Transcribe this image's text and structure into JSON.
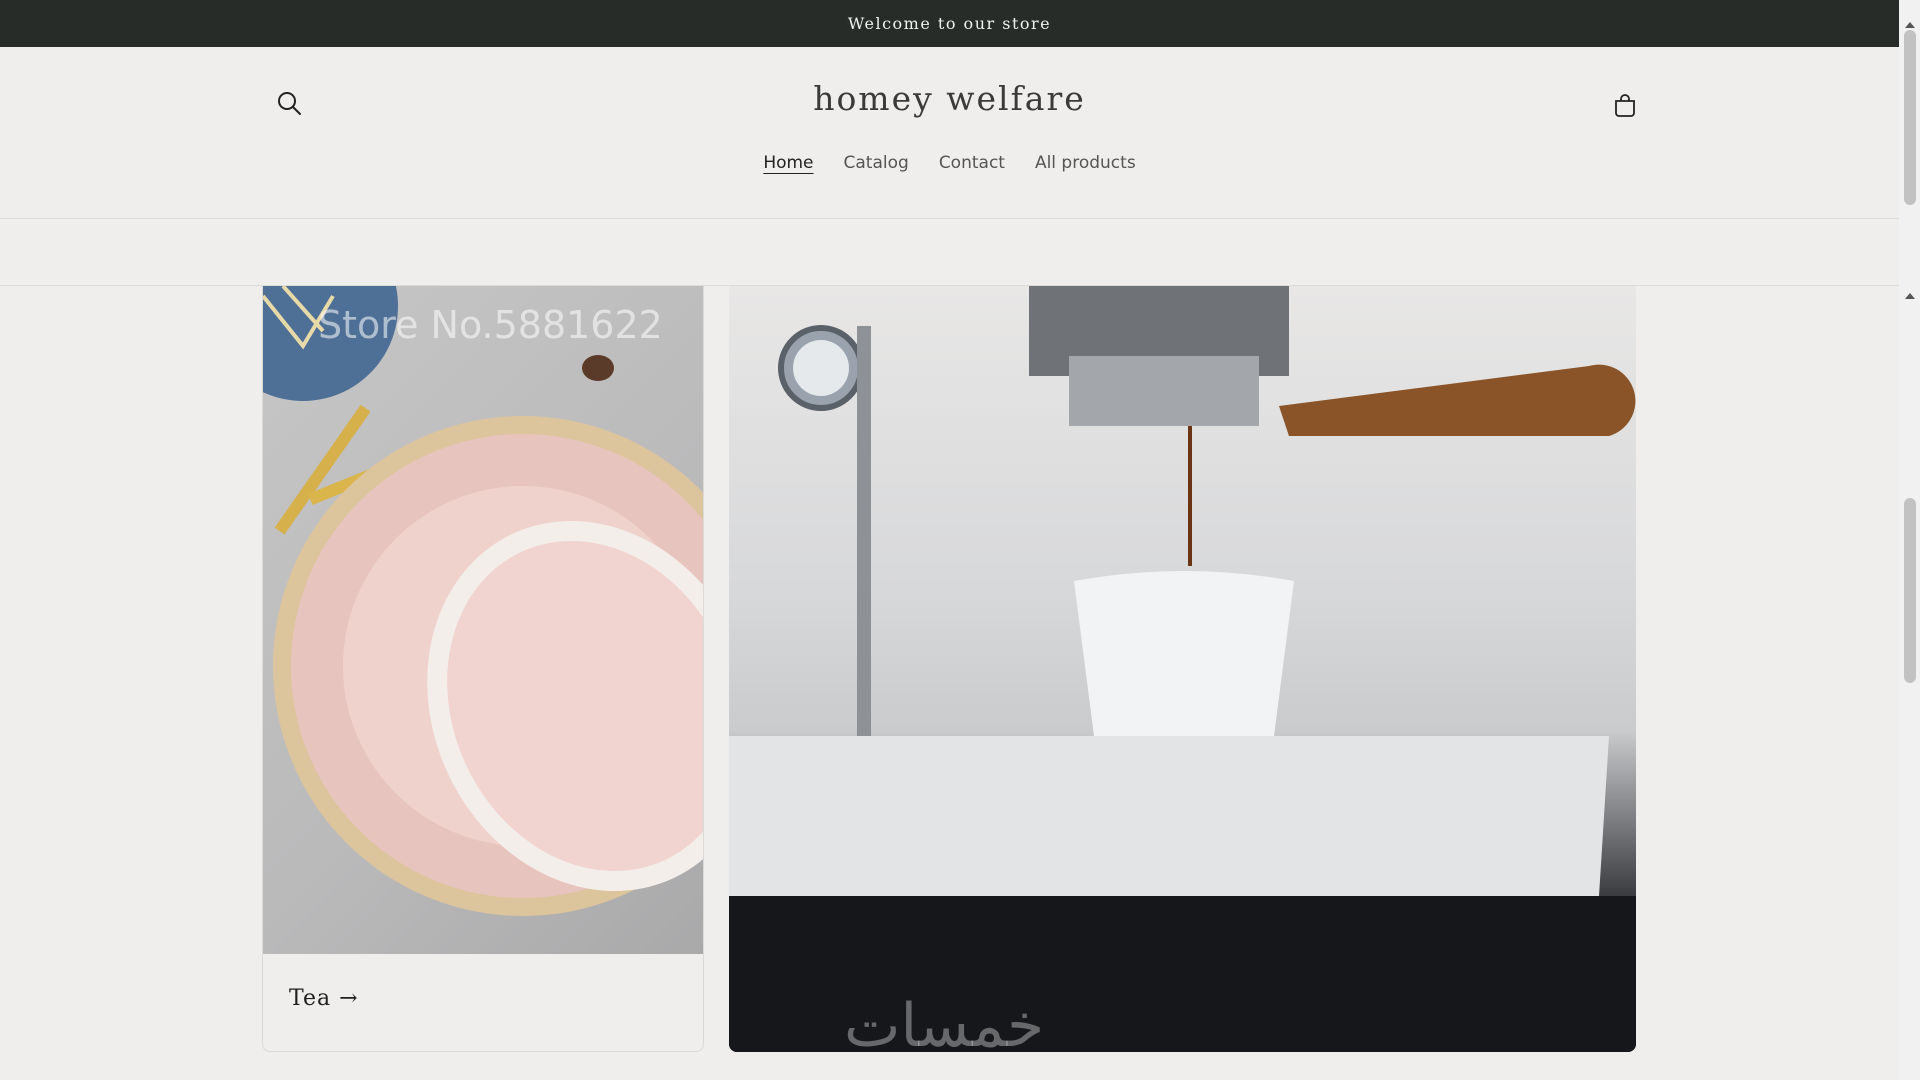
{
  "announcement": {
    "text": "Welcome to our store"
  },
  "header": {
    "logo": "homey welfare",
    "nav": [
      {
        "label": "Home",
        "active": true
      },
      {
        "label": "Catalog",
        "active": false
      },
      {
        "label": "Contact",
        "active": false
      },
      {
        "label": "All products",
        "active": false
      }
    ],
    "icons": {
      "search": "search-icon",
      "cart": "cart-icon"
    }
  },
  "collections": [
    {
      "label": "Tea →",
      "image_watermark": "Store No.5881622"
    },
    {
      "label": "",
      "image_watermark": "خمسات"
    }
  ],
  "colors": {
    "announcement_bg": "#272c29",
    "page_bg": "#efeeec",
    "text": "#2b2b2b"
  }
}
